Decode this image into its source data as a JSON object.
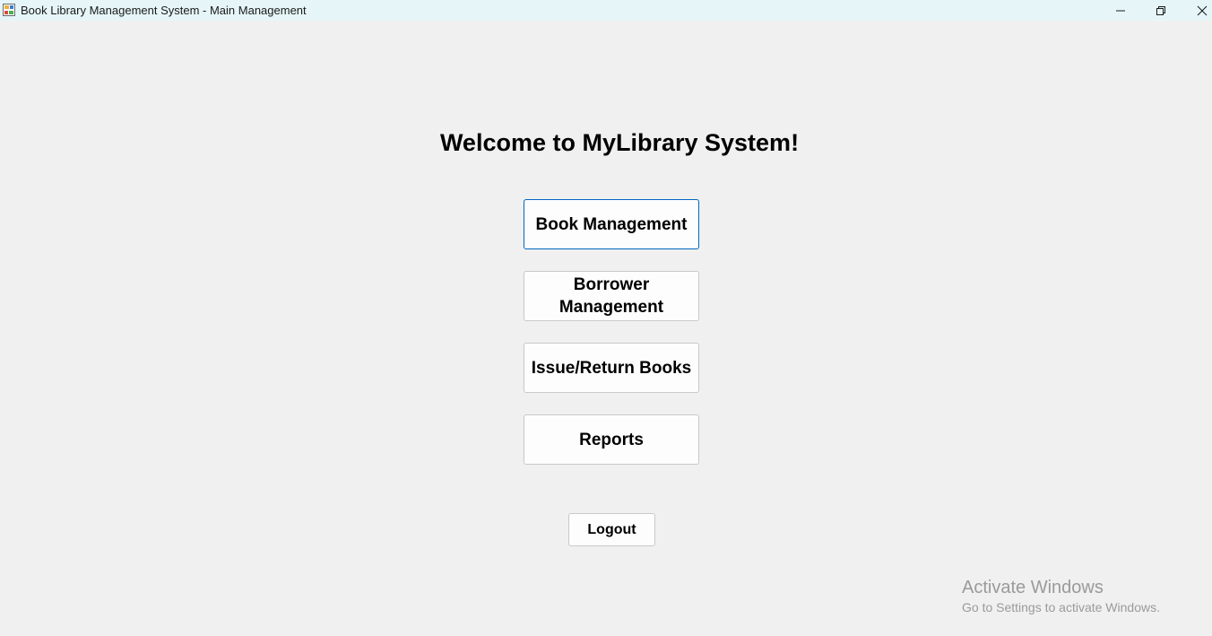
{
  "window": {
    "title": "Book Library Management System - Main Management",
    "icon": "app-form-icon",
    "controls": {
      "minimize_icon": "minimize-icon",
      "maximize_icon": "restore-icon",
      "close_icon": "close-icon"
    }
  },
  "main": {
    "welcome_text": "Welcome to MyLibrary System!",
    "buttons": [
      {
        "label": "Book Management"
      },
      {
        "label": "Borrower Management"
      },
      {
        "label": "Issue/Return Books"
      },
      {
        "label": "Reports"
      }
    ],
    "logout_label": "Logout"
  },
  "watermark": {
    "title": "Activate Windows",
    "subtitle": "Go to Settings to activate Windows."
  },
  "colors": {
    "background": "#f0f0f0",
    "titlebar": "#e6f6f8",
    "focus_border": "#0067c0"
  }
}
